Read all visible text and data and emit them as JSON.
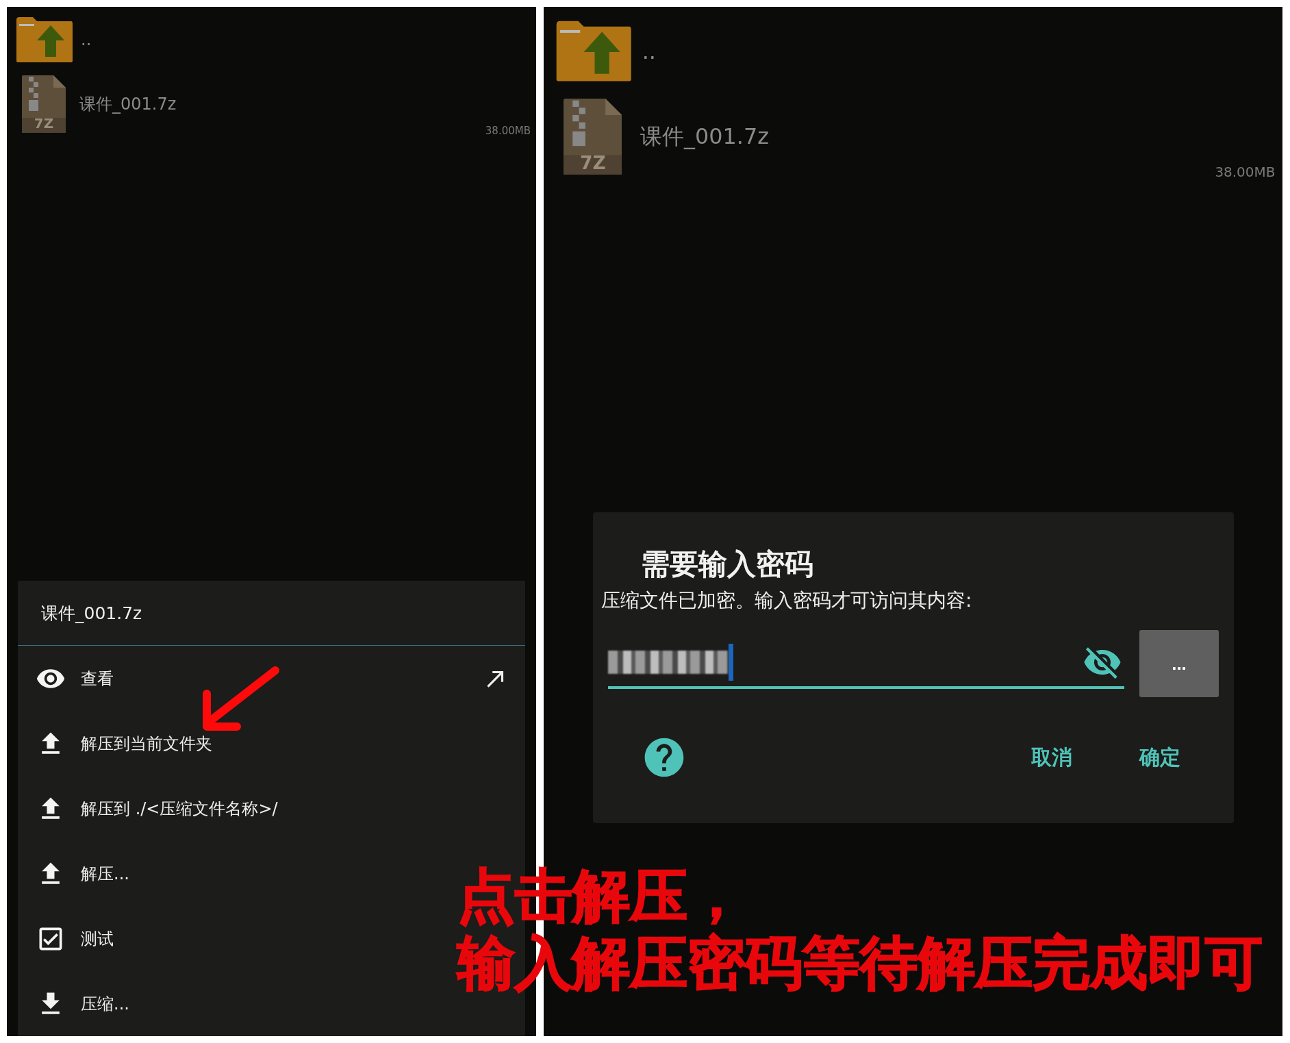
{
  "left_screen": {
    "file_list": [
      {
        "kind": "parent",
        "name": ".."
      },
      {
        "kind": "archive",
        "name": "课件_001.7z",
        "icon_label": "7Z",
        "size": "38.00MB"
      }
    ],
    "menu": {
      "title": "课件_001.7z",
      "items": [
        {
          "kind": "view",
          "label": "查看"
        },
        {
          "kind": "extract",
          "label": "解压到当前文件夹"
        },
        {
          "kind": "extract",
          "label": "解压到 ./<压缩文件名称>/"
        },
        {
          "kind": "extract",
          "label": "解压..."
        },
        {
          "kind": "test",
          "label": "测试"
        },
        {
          "kind": "compress",
          "label": "压缩..."
        }
      ]
    }
  },
  "right_screen": {
    "file_list": [
      {
        "kind": "parent",
        "name": ".."
      },
      {
        "kind": "archive",
        "name": "课件_001.7z",
        "icon_label": "7Z",
        "size": "38.00MB"
      }
    ],
    "dialog": {
      "title": "需要输入密码",
      "message": "压缩文件已加密。输入密码才可访问其内容:",
      "more_button": "...",
      "cancel": "取消",
      "confirm": "确定"
    }
  },
  "annotation": {
    "lines": [
      "点击解压，",
      "输入解压密码等待解压完成即可"
    ]
  }
}
